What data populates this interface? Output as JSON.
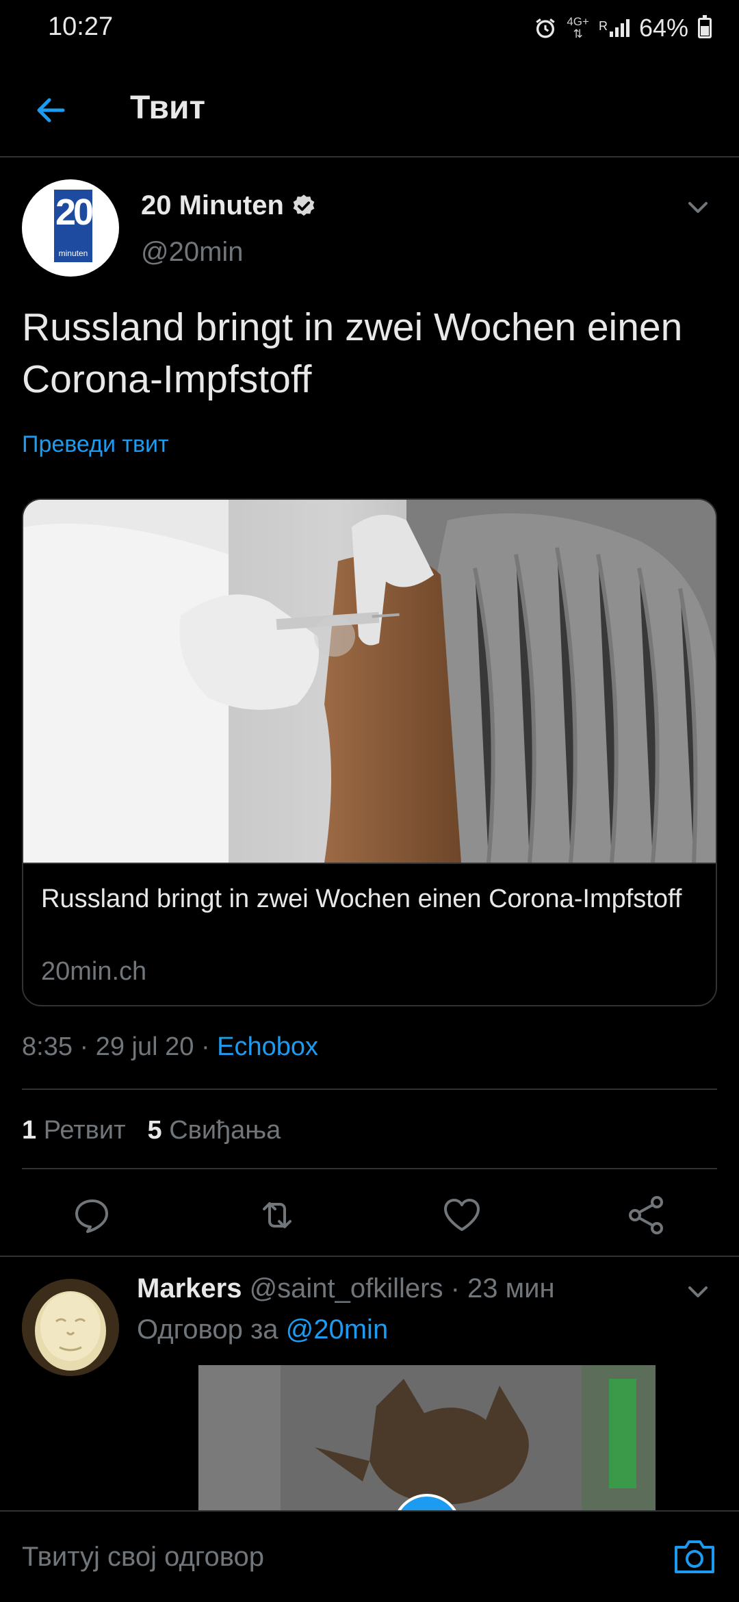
{
  "status_bar": {
    "time": "10:27",
    "network_top": "4G+",
    "network_roam": "R",
    "battery": "64%"
  },
  "header": {
    "title": "Твит"
  },
  "tweet": {
    "author_name": "20 Minuten",
    "author_handle": "@20min",
    "avatar_logo_number": "20",
    "avatar_logo_word": "minuten",
    "text": "Russland bringt in zwei Wochen einen Corona-Impfstoff",
    "translate_label": "Преведи твит",
    "card": {
      "title": "Russland bringt in zwei Wochen einen Corona-Impfstoff",
      "domain": "20min.ch"
    },
    "timestamp": "8:35 · 29 jul 20 · ",
    "source": "Echobox",
    "retweets_count": "1",
    "retweets_label": "Ретвит",
    "likes_count": "5",
    "likes_label": "Свиђања"
  },
  "reply": {
    "name": "Markers",
    "handle": "@saint_ofkillers",
    "time": " · 23 мин",
    "replying_to_label": "Одговор за ",
    "replying_to_mention": "@20min"
  },
  "compose": {
    "placeholder": "Твитуј свој одговор"
  },
  "colors": {
    "accent": "#1d9bf0",
    "background": "#000000",
    "divider": "#2f3336",
    "secondary_text": "#71767b"
  }
}
